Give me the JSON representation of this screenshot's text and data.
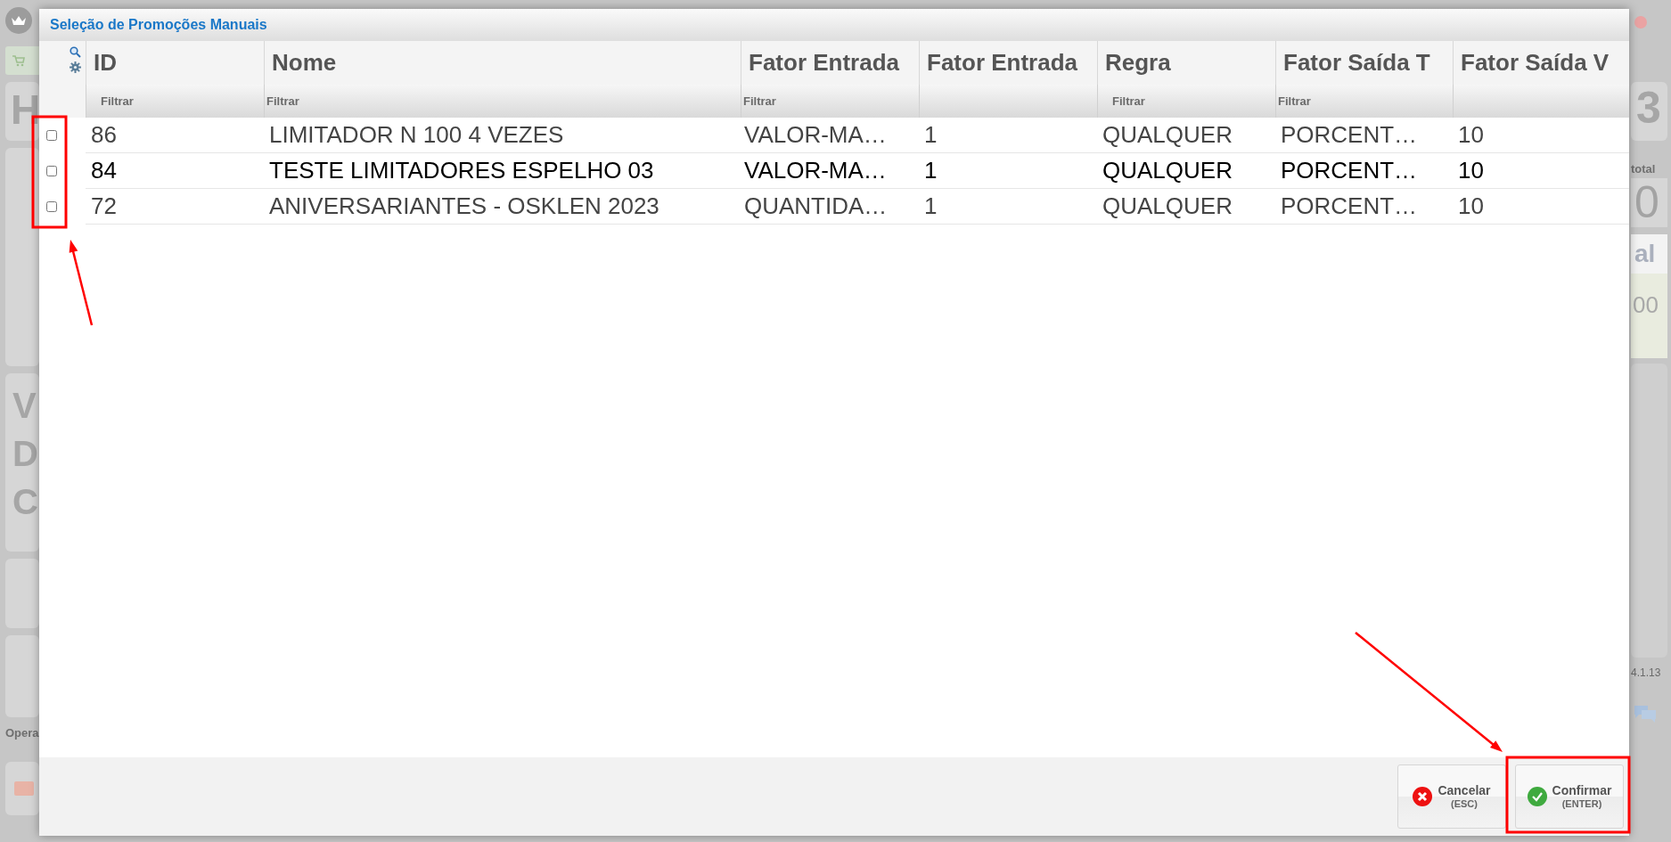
{
  "window": {
    "title": "Seleção de Promoções Manuais"
  },
  "table": {
    "columns": [
      {
        "label": "ID",
        "filter_placeholder": "Filtrar"
      },
      {
        "label": "Nome",
        "filter_placeholder": "Filtrar"
      },
      {
        "label": "Fator Entrada",
        "filter_placeholder": "Filtrar"
      },
      {
        "label": "Fator Entrada"
      },
      {
        "label": "Regra",
        "filter_placeholder": "Filtrar"
      },
      {
        "label": "Fator Saída T",
        "filter_placeholder": "Filtrar"
      },
      {
        "label": "Fator Saída V"
      }
    ],
    "rows": [
      {
        "checked": false,
        "selected": false,
        "cells": [
          "86",
          "LIMITADOR N 100 4 VEZES",
          "VALOR-MA…",
          "1",
          "QUALQUER",
          "PORCENT…",
          "10"
        ]
      },
      {
        "checked": false,
        "selected": true,
        "cells": [
          "84",
          "TESTE LIMITADORES ESPELHO 03",
          "VALOR-MA…",
          "1",
          "QUALQUER",
          "PORCENT…",
          "10"
        ]
      },
      {
        "checked": false,
        "selected": false,
        "cells": [
          "72",
          "ANIVERSARIANTES - OSKLEN 2023",
          "QUANTIDA…",
          "1",
          "QUALQUER",
          "PORCENT…",
          "10"
        ]
      }
    ]
  },
  "buttons": [
    {
      "kind": "cancel",
      "label": "Cancelar",
      "shortcut": "(ESC)"
    },
    {
      "kind": "confirm",
      "label": "Confirmar",
      "shortcut": "(ENTER)"
    }
  ],
  "background": {
    "left": {
      "tile_letter": "H",
      "block_letters": [
        "V",
        "D",
        "C"
      ],
      "footer_text": "Opera"
    },
    "right": {
      "tile_digit": "3",
      "total_label": "total",
      "total_value": "0",
      "label": "al",
      "value": "00",
      "version": "4.1.13"
    }
  }
}
